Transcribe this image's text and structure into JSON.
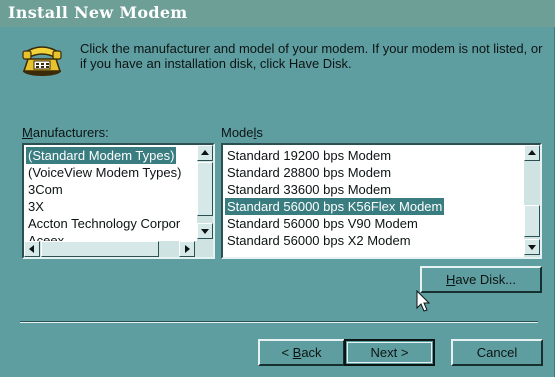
{
  "window": {
    "title": "Install New Modem"
  },
  "intro": {
    "text": "Click the manufacturer and model of your modem. If your modem is not listed, or if you have an installation disk, click Have Disk."
  },
  "manufacturers": {
    "label_access": "M",
    "label_rest": "anufacturers:",
    "items": [
      "(Standard Modem Types)",
      "(VoiceView Modem Types)",
      "3Com",
      "3X",
      "Accton Technology Corpor",
      "Aceex"
    ],
    "selected": "(Standard Modem Types)"
  },
  "models": {
    "label_pre": "Mode",
    "label_access": "l",
    "label_post": "s",
    "items": [
      "Standard 19200 bps Modem",
      "Standard 28800 bps Modem",
      "Standard 33600 bps Modem",
      "Standard 56000 bps K56Flex Modem",
      "Standard 56000 bps V90 Modem",
      "Standard 56000 bps X2 Modem"
    ],
    "selected": "Standard 56000 bps K56Flex Modem"
  },
  "buttons": {
    "have_disk_access": "H",
    "have_disk_rest": "ave Disk...",
    "back_pre": "< ",
    "back_access": "B",
    "back_rest": "ack",
    "next": "Next >",
    "cancel": "Cancel"
  },
  "icons": {
    "modem": "telephone-icon",
    "cursor": "mouse-pointer-icon"
  }
}
